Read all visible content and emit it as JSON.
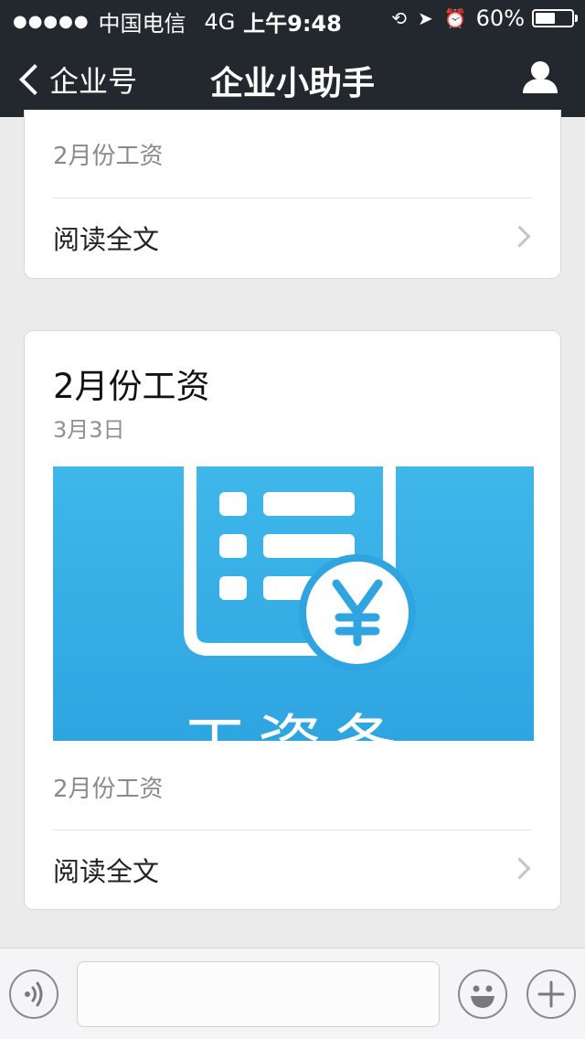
{
  "status_bar": {
    "signal": "●●●●●",
    "carrier": "中国电信",
    "network": "4G",
    "time": "上午9:48",
    "battery": "60%",
    "battery_level": 0.6
  },
  "nav": {
    "back_label": "企业号",
    "title": "企业小助手"
  },
  "messages": [
    {
      "summary": "2月份工资",
      "read_more": "阅读全文"
    },
    {
      "title": "2月份工资",
      "date": "3月3日",
      "cover_text": "工资条",
      "summary": "2月份工资",
      "read_more": "阅读全文"
    }
  ],
  "input_bar": {
    "value": "",
    "placeholder": ""
  },
  "colors": {
    "header_bg": "#23282e",
    "cover_blue": "#3aafe6",
    "page_bg": "#ebebeb"
  }
}
